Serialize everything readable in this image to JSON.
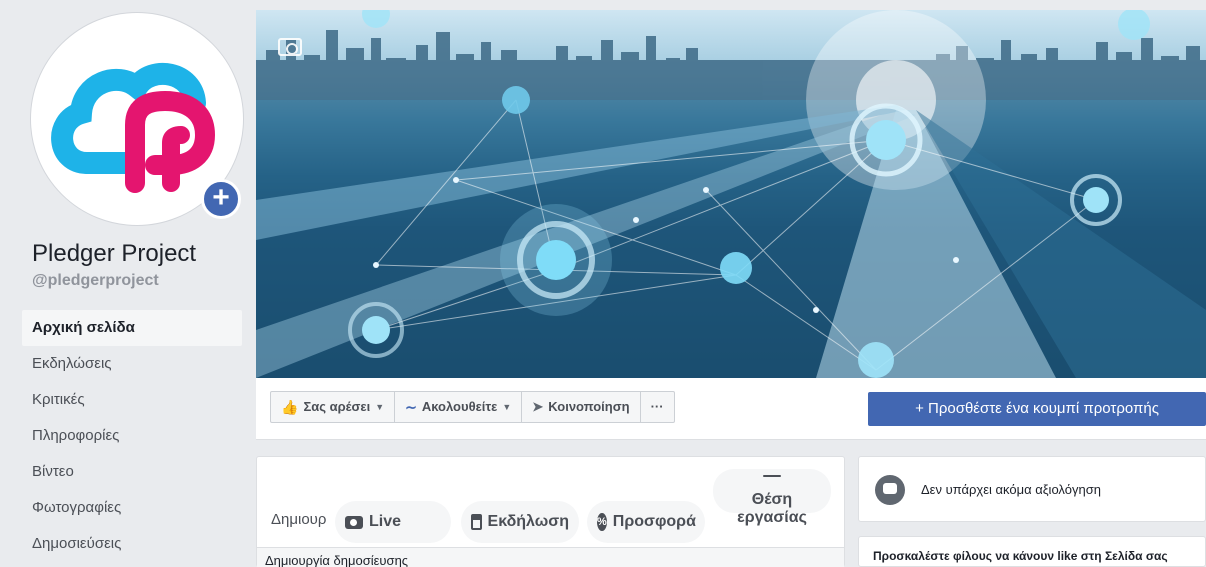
{
  "profile": {
    "name": "Pledger Project",
    "handle": "@pledgerproject",
    "add_photo_label": "+"
  },
  "nav": {
    "items": [
      {
        "label": "Αρχική σελίδα",
        "active": true
      },
      {
        "label": "Εκδηλώσεις",
        "active": false
      },
      {
        "label": "Κριτικές",
        "active": false
      },
      {
        "label": "Πληροφορίες",
        "active": false
      },
      {
        "label": "Βίντεο",
        "active": false
      },
      {
        "label": "Φωτογραφίες",
        "active": false
      },
      {
        "label": "Δημοσιεύσεις",
        "active": false
      }
    ]
  },
  "action_bar": {
    "like_label": "Σας αρέσει",
    "follow_label": "Ακολουθείτε",
    "share_label": "Κοινοποίηση",
    "more_label": "···",
    "cta_label": "+ Προσθέστε ένα κουμπί προτροπής"
  },
  "composer": {
    "label": "Δημιουρ",
    "live_label": "Live",
    "event_label": "Εκδήλωση",
    "offer_label": "Προσφορά",
    "job_label_line1": "Θέση",
    "job_label_line2": "εργασίας",
    "footer_label": "Δημιουργία δημοσίευσης"
  },
  "right": {
    "review_text": "Δεν υπάρχει ακόμα αξιολόγηση",
    "invite_text": "Προσκαλέστε φίλους να κάνουν like στη Σελίδα σας"
  },
  "colors": {
    "brand_blue": "#4267b2",
    "logo_cyan": "#1eb3e8",
    "logo_pink": "#e4156f"
  }
}
